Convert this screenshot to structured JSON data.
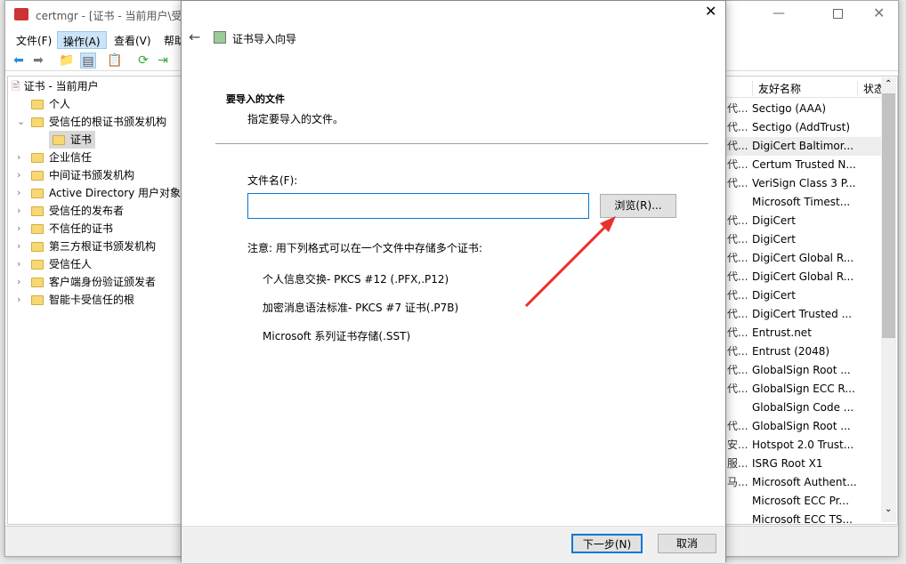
{
  "main_window": {
    "title": "certmgr - [证书 - 当前用户\\受",
    "menus": [
      "文件(F)",
      "操作(A)",
      "查看(V)",
      "帮助"
    ],
    "active_menu": "操作(A)",
    "tree": {
      "root": "证书 - 当前用户",
      "items": [
        {
          "label": "个人",
          "expander": ""
        },
        {
          "label": "受信任的根证书颁发机构",
          "expander": "⌄"
        },
        {
          "label": "证书",
          "expander": "",
          "selected": true
        },
        {
          "label": "企业信任",
          "expander": "›"
        },
        {
          "label": "中间证书颁发机构",
          "expander": "›"
        },
        {
          "label": "Active Directory 用户对象",
          "expander": "›"
        },
        {
          "label": "受信任的发布者",
          "expander": "›"
        },
        {
          "label": "不信任的证书",
          "expander": "›"
        },
        {
          "label": "第三方根证书颁发机构",
          "expander": "›"
        },
        {
          "label": "受信任人",
          "expander": "›"
        },
        {
          "label": "客户端身份验证颁发者",
          "expander": "›"
        },
        {
          "label": "智能卡受信任的根",
          "expander": "›"
        }
      ]
    },
    "list": {
      "columns": [
        "友好名称",
        "状态"
      ],
      "rows": [
        {
          "c1": "代...",
          "name": "Sectigo (AAA)"
        },
        {
          "c1": "代...",
          "name": "Sectigo (AddTrust)"
        },
        {
          "c1": "代...",
          "name": "DigiCert Baltimor...",
          "selected": true
        },
        {
          "c1": "代...",
          "name": "Certum Trusted N..."
        },
        {
          "c1": "代...",
          "name": "VeriSign Class 3 P..."
        },
        {
          "c1": "",
          "name": "Microsoft Timest..."
        },
        {
          "c1": "代...",
          "name": "DigiCert"
        },
        {
          "c1": "代...",
          "name": "DigiCert"
        },
        {
          "c1": "代...",
          "name": "DigiCert Global R..."
        },
        {
          "c1": "代...",
          "name": "DigiCert Global R..."
        },
        {
          "c1": "代...",
          "name": "DigiCert"
        },
        {
          "c1": "代...",
          "name": "DigiCert Trusted ..."
        },
        {
          "c1": "代...",
          "name": "Entrust.net"
        },
        {
          "c1": "代...",
          "name": "Entrust (2048)"
        },
        {
          "c1": "代...",
          "name": "GlobalSign Root ..."
        },
        {
          "c1": "代...",
          "name": "GlobalSign ECC R..."
        },
        {
          "c1": "",
          "name": "GlobalSign Code ..."
        },
        {
          "c1": "代...",
          "name": "GlobalSign Root ..."
        },
        {
          "c1": "安...",
          "name": "Hotspot 2.0 Trust..."
        },
        {
          "c1": "服...",
          "name": "ISRG Root X1"
        },
        {
          "c1": "马...",
          "name": "Microsoft Authent..."
        },
        {
          "c1": "",
          "name": "Microsoft ECC Pr..."
        },
        {
          "c1": "",
          "name": "Microsoft ECC TS..."
        }
      ]
    }
  },
  "dialog": {
    "title": "证书导入向导",
    "heading": "要导入的文件",
    "subheading": "指定要导入的文件。",
    "file_label": "文件名(F):",
    "file_value": "",
    "browse": "浏览(R)...",
    "note": "注意: 用下列格式可以在一个文件中存储多个证书:",
    "formats": [
      "个人信息交换- PKCS #12 (.PFX,.P12)",
      "加密消息语法标准- PKCS #7 证书(.P7B)",
      "Microsoft 系列证书存储(.SST)"
    ],
    "next": "下一步(N)",
    "cancel": "取消"
  },
  "annotation": {
    "arrow_color": "#e8322a"
  }
}
